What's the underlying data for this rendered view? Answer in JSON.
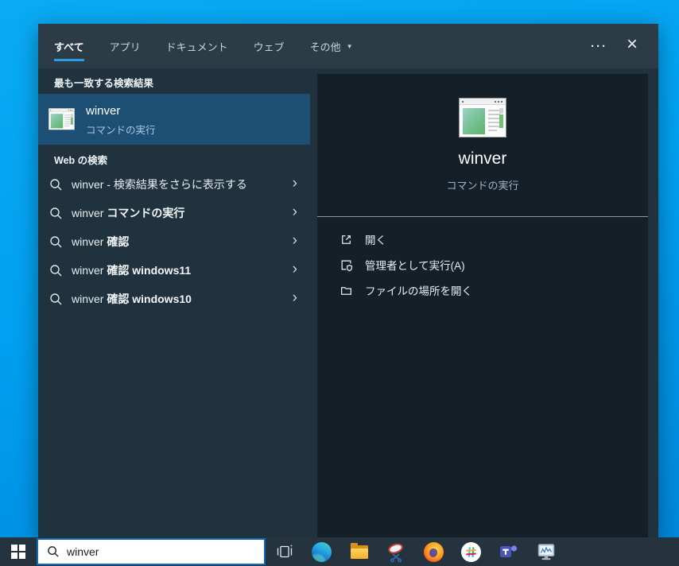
{
  "flyout": {
    "tabs": [
      {
        "label": "すべて",
        "active": true
      },
      {
        "label": "アプリ",
        "active": false
      },
      {
        "label": "ドキュメント",
        "active": false
      },
      {
        "label": "ウェブ",
        "active": false
      },
      {
        "label": "その他",
        "active": false,
        "has_dropdown": true
      }
    ],
    "best_match": {
      "section_title": "最も一致する検索結果",
      "result": {
        "title": "winver",
        "subtitle": "コマンドの実行"
      }
    },
    "web_search": {
      "section_title": "Web の検索",
      "suggestions": [
        {
          "query": "winver",
          "rest": " - 検索結果をさらに表示する",
          "bold_rest": false
        },
        {
          "query": "winver",
          "rest": " コマンドの実行",
          "bold_rest": true
        },
        {
          "query": "winver",
          "rest": " 確認",
          "bold_rest": true
        },
        {
          "query": "winver",
          "rest": " 確認 windows11",
          "bold_rest": true
        },
        {
          "query": "winver",
          "rest": " 確認 windows10",
          "bold_rest": true
        }
      ]
    },
    "preview": {
      "title": "winver",
      "subtitle": "コマンドの実行",
      "actions": [
        {
          "label": "開く",
          "icon": "open-icon"
        },
        {
          "label": "管理者として実行(A)",
          "icon": "run-as-admin-icon"
        },
        {
          "label": "ファイルの場所を開く",
          "icon": "open-file-location-icon"
        }
      ]
    }
  },
  "taskbar": {
    "search_value": "winver",
    "icons": [
      "start",
      "search-box",
      "task-view",
      "edge",
      "file-explorer",
      "snipping-tool",
      "firefox",
      "slack",
      "teams",
      "task-manager"
    ]
  },
  "colors": {
    "accent_underline": "#2d9ce8",
    "selection": "#1d4e74",
    "flyout_bg": "#1f323d",
    "header_bg": "#2b3c47",
    "preview_bg": "#141f27",
    "taskbar_bg": "#24333e",
    "desktop_top": "#0aabf4",
    "desktop_bottom": "#0086da",
    "search_border": "#0b69b7"
  }
}
